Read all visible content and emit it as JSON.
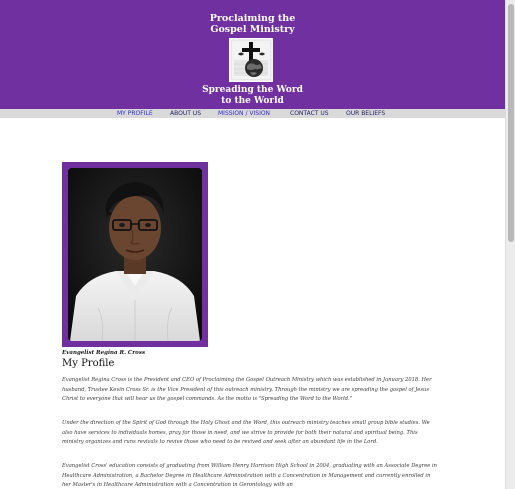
{
  "header": {
    "title_line1": "Proclaiming the",
    "title_line2": "Gospel Ministry",
    "tagline_line1": "Spreading the Word",
    "tagline_line2": "to the World",
    "background_color": "#7030a0"
  },
  "nav": {
    "items": [
      {
        "label": "MY PROFILE",
        "active": true
      },
      {
        "label": "ABOUT US",
        "active": false
      },
      {
        "label": "MISSION / VISION",
        "active": true
      },
      {
        "label": "CONTACT US",
        "active": false
      },
      {
        "label": "OUR BELIEFS",
        "active": false
      }
    ]
  },
  "profile": {
    "caption": "Evangelist Regina R. Cross",
    "heading": "My Profile",
    "paragraphs": [
      "Evangelist Regina Cross is the President and CEO of Proclaiming the Gospel Outreach Ministry which was established in January 2018. Her husband, Trustee Kevin Cross Sr. is the Vice President of this outreach ministry. Through the ministry we are spreading the gospel of Jesus Christ to everyone that will hear us the gospel commands. As the motto is \"Spreading the Word to the World.\"",
      "Under the direction of the Spirit of God through the Holy Ghost and the Word, this outreach ministry teaches small group bible studies. We also have services to individuals homes, pray for those in need, and we strive to provide for both their natural and spiritual being. This ministry organizes and runs revivals to revive those who need to be revived and seek after an abundant life in the Lord.",
      "Evangelist Cross' education consists of graduating from William Henry Harrison High School in 2004, graduating with an Associate Degree in Healthcare Administration, a Bachelor Degree in Healthcare Administration with a Concentration in Management and currently enrolled in her Master's in Healthcare Administration with a Concentration in Gerontology with an"
    ]
  }
}
